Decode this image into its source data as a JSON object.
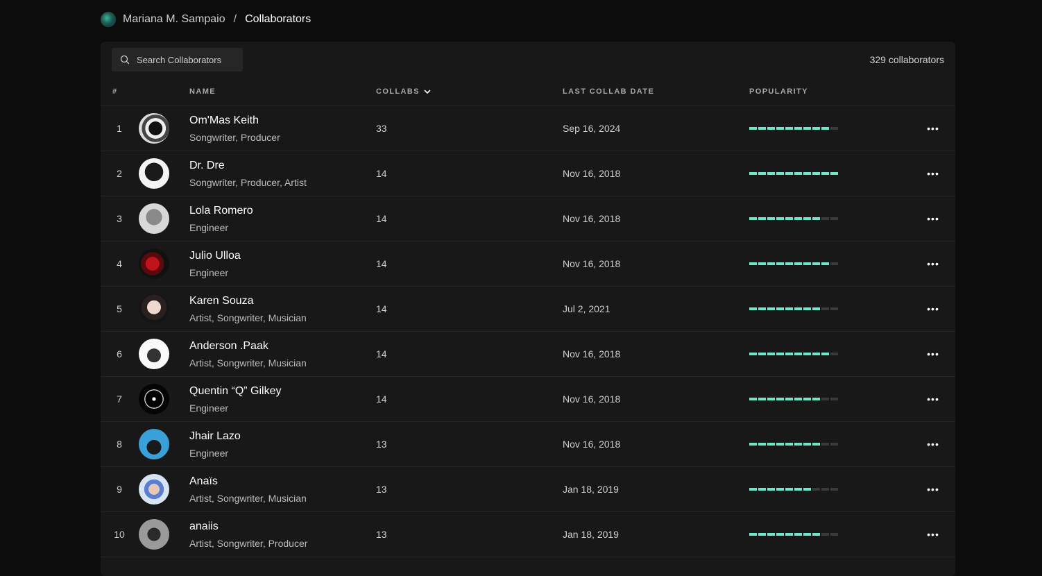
{
  "breadcrumb": {
    "user": "Mariana M. Sampaio",
    "separator": "/",
    "current": "Collaborators"
  },
  "search": {
    "placeholder": "Search Collaborators",
    "value": ""
  },
  "count_text": "329 collaborators",
  "columns": {
    "num": "#",
    "name": "NAME",
    "collabs": "COLLABS",
    "last_date": "LAST COLLAB DATE",
    "popularity": "POPULARITY"
  },
  "colors": {
    "accent": "#6ee7c8",
    "background": "#0c0c0c",
    "panel": "#181818"
  },
  "popularity_segments": 10,
  "rows": [
    {
      "num": "1",
      "name": "Om'Mas Keith",
      "roles": "Songwriter, Producer",
      "collabs": "33",
      "date": "Sep 16, 2024",
      "popularity": 0.9,
      "avatar": "bw-pattern"
    },
    {
      "num": "2",
      "name": "Dr. Dre",
      "roles": "Songwriter, Producer, Artist",
      "collabs": "14",
      "date": "Nov 16, 2018",
      "popularity": 1.0,
      "avatar": "bw-portrait"
    },
    {
      "num": "3",
      "name": "Lola Romero",
      "roles": "Engineer",
      "collabs": "14",
      "date": "Nov 16, 2018",
      "popularity": 0.8,
      "avatar": "gray-portrait"
    },
    {
      "num": "4",
      "name": "Julio Ulloa",
      "roles": "Engineer",
      "collabs": "14",
      "date": "Nov 16, 2018",
      "popularity": 0.9,
      "avatar": "red-dark"
    },
    {
      "num": "5",
      "name": "Karen Souza",
      "roles": "Artist, Songwriter, Musician",
      "collabs": "14",
      "date": "Jul 2, 2021",
      "popularity": 0.8,
      "avatar": "light-portrait"
    },
    {
      "num": "6",
      "name": "Anderson .Paak",
      "roles": "Artist, Songwriter, Musician",
      "collabs": "14",
      "date": "Nov 16, 2018",
      "popularity": 0.9,
      "avatar": "white-bg"
    },
    {
      "num": "7",
      "name": "Quentin “Q” Gilkey",
      "roles": "Engineer",
      "collabs": "14",
      "date": "Nov 16, 2018",
      "popularity": 0.8,
      "avatar": "dark-bw"
    },
    {
      "num": "8",
      "name": "Jhair Lazo",
      "roles": "Engineer",
      "collabs": "13",
      "date": "Nov 16, 2018",
      "popularity": 0.8,
      "avatar": "blue-sky"
    },
    {
      "num": "9",
      "name": "Anaïs",
      "roles": "Artist, Songwriter, Musician",
      "collabs": "13",
      "date": "Jan 18, 2019",
      "popularity": 0.7,
      "avatar": "light-blue"
    },
    {
      "num": "10",
      "name": "anaiis",
      "roles": "Artist, Songwriter, Producer",
      "collabs": "13",
      "date": "Jan 18, 2019",
      "popularity": 0.8,
      "avatar": "gray-bw"
    }
  ]
}
